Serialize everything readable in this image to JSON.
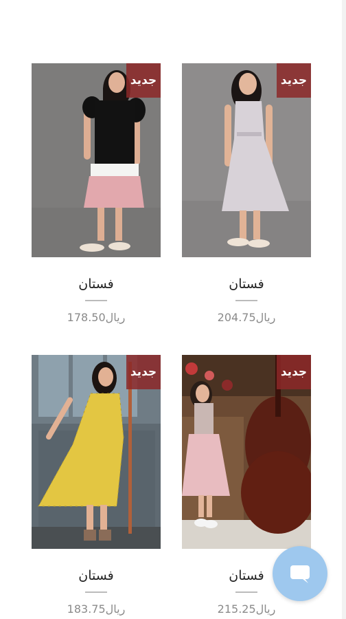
{
  "products": [
    {
      "title": "فستان",
      "price": "204.75ريال",
      "badge": "جديد",
      "image": "girl-white-lace-dress"
    },
    {
      "title": "فستان",
      "price": "178.50ريال",
      "badge": "جديد",
      "image": "girl-black-pink-dress"
    },
    {
      "title": "فستان",
      "price": "215.25ريال",
      "badge": "جديد",
      "image": "girl-pink-tulle-dress-cello"
    },
    {
      "title": "فستان",
      "price": "183.75ريال",
      "badge": "جديد",
      "image": "girl-yellow-floral-dress"
    }
  ],
  "chat": {
    "icon": "chat-bubble-icon"
  },
  "colors": {
    "badge": "#8c2828",
    "chat_button": "#9ec8ee",
    "price": "#8a8a8a"
  }
}
